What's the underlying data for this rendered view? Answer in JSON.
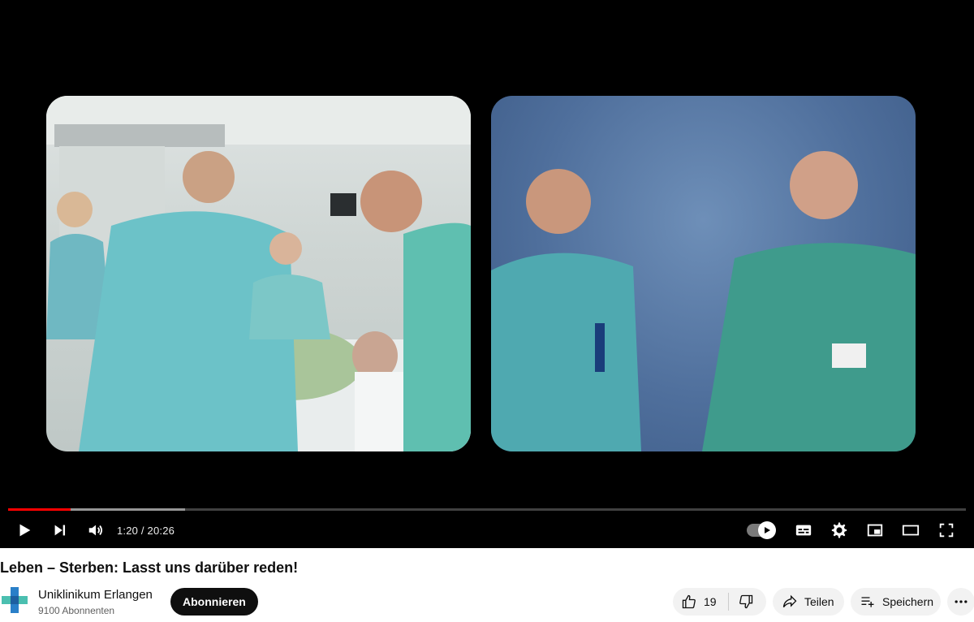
{
  "player": {
    "time_display": "1:20 / 20:26",
    "progress_fraction": 0.065,
    "buffered_fraction": 0.185,
    "progress_color": "#ff0000"
  },
  "controls": {
    "left": [
      "play-icon",
      "next-icon",
      "volume-icon"
    ],
    "right": [
      "autoplay-toggle-icon",
      "subtitles-icon",
      "settings-gear-icon",
      "miniplayer-icon",
      "theater-mode-icon",
      "fullscreen-icon"
    ]
  },
  "video": {
    "title": "Leben – Sterben: Lasst uns darüber reden!"
  },
  "channel": {
    "name": "Uniklinikum Erlangen",
    "subscribers": "9100 Abonnenten",
    "subscribe_label": "Abonnieren",
    "logo_colors": [
      "#2a7fc8",
      "#4bbfb0",
      "#1e5fa0"
    ]
  },
  "actions": {
    "like_count": "19",
    "share_label": "Teilen",
    "save_label": "Speichern"
  }
}
